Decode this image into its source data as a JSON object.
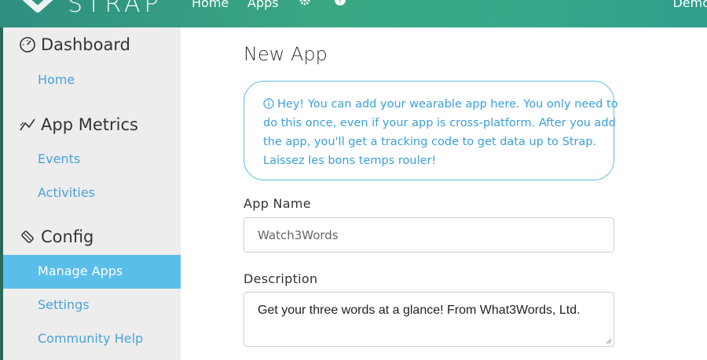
{
  "header": {
    "brand": "STRAP",
    "nav": {
      "home": "Home",
      "apps": "Apps"
    },
    "icons": {
      "logo": "strap-logo-icon",
      "settings": "gear-icon",
      "help": "help-icon"
    },
    "user": "Demo"
  },
  "sidebar": {
    "sections": [
      {
        "title": "Dashboard",
        "icon": "gauge-icon",
        "items": [
          "Home"
        ]
      },
      {
        "title": "App Metrics",
        "icon": "trend-icon",
        "items": [
          "Events",
          "Activities"
        ]
      },
      {
        "title": "Config",
        "icon": "wrench-icon",
        "items": [
          "Manage Apps",
          "Settings",
          "Community Help"
        ]
      }
    ],
    "active_item": "Manage Apps"
  },
  "main": {
    "title": "New App",
    "alert": {
      "icon": "info-icon",
      "lines": [
        "Hey! You can add your wearable app here. You only need to",
        "do this once, even if your app is cross-platform. After you add",
        "the app, you'll get a tracking code to get data up to Strap.",
        "Laissez les bons temps rouler!"
      ]
    },
    "app_name": {
      "label": "App Name",
      "value": "Watch3Words"
    },
    "description": {
      "label": "Description",
      "value": "Get your three words at a glance! From What3Words, Ltd."
    }
  },
  "colors": {
    "header_gradient": [
      "#2e8f7f",
      "#3aa784"
    ],
    "sidebar_bg": "#ededed",
    "active_item": "#5bbde9",
    "link": "#4aa3d8",
    "alert_border": "#5bc0e8"
  }
}
